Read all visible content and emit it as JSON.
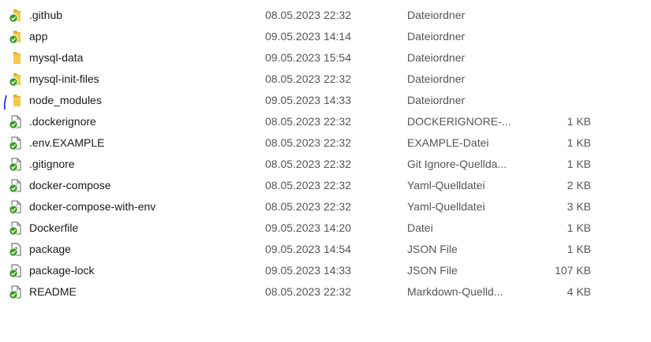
{
  "files": [
    {
      "name": ".github",
      "date": "08.05.2023 22:32",
      "type": "Dateiordner",
      "size": "",
      "icon": "folder-synced-icon"
    },
    {
      "name": "app",
      "date": "09.05.2023 14:14",
      "type": "Dateiordner",
      "size": "",
      "icon": "folder-synced-icon"
    },
    {
      "name": "mysql-data",
      "date": "09.05.2023 15:54",
      "type": "Dateiordner",
      "size": "",
      "icon": "folder-icon"
    },
    {
      "name": "mysql-init-files",
      "date": "08.05.2023 22:32",
      "type": "Dateiordner",
      "size": "",
      "icon": "folder-synced-icon"
    },
    {
      "name": "node_modules",
      "date": "09.05.2023 14:33",
      "type": "Dateiordner",
      "size": "",
      "icon": "folder-icon"
    },
    {
      "name": ".dockerignore",
      "date": "08.05.2023 22:32",
      "type": "DOCKERIGNORE-...",
      "size": "1 KB",
      "icon": "file-synced-icon"
    },
    {
      "name": ".env.EXAMPLE",
      "date": "08.05.2023 22:32",
      "type": "EXAMPLE-Datei",
      "size": "1 KB",
      "icon": "file-synced-icon"
    },
    {
      "name": ".gitignore",
      "date": "08.05.2023 22:32",
      "type": "Git Ignore-Quellda...",
      "size": "1 KB",
      "icon": "code-file-synced-icon"
    },
    {
      "name": "docker-compose",
      "date": "08.05.2023 22:32",
      "type": "Yaml-Quelldatei",
      "size": "2 KB",
      "icon": "code-file-synced-icon"
    },
    {
      "name": "docker-compose-with-env",
      "date": "08.05.2023 22:32",
      "type": "Yaml-Quelldatei",
      "size": "3 KB",
      "icon": "code-file-synced-icon"
    },
    {
      "name": "Dockerfile",
      "date": "09.05.2023 14:20",
      "type": "Datei",
      "size": "1 KB",
      "icon": "file-synced-icon"
    },
    {
      "name": "package",
      "date": "09.05.2023 14:54",
      "type": "JSON File",
      "size": "1 KB",
      "icon": "json-file-synced-icon"
    },
    {
      "name": "package-lock",
      "date": "09.05.2023 14:33",
      "type": "JSON File",
      "size": "107 KB",
      "icon": "json-file-synced-icon"
    },
    {
      "name": "README",
      "date": "08.05.2023 22:32",
      "type": "Markdown-Quelld...",
      "size": "4 KB",
      "icon": "code-file-synced-icon"
    }
  ],
  "colors": {
    "folder": "#f7c948",
    "sync_badge": "#3a9d23",
    "selection": "#e5f3ff",
    "pen_mark": "#1a1aff"
  }
}
